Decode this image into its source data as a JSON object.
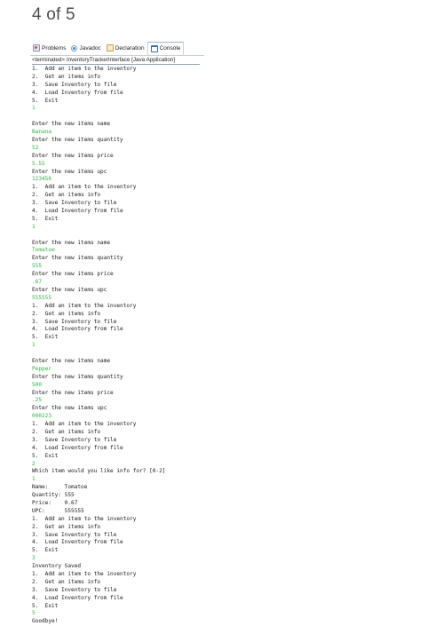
{
  "page_counter": "4 of 5",
  "tabs": [
    {
      "label": "Problems",
      "icon": "problems-icon"
    },
    {
      "label": "Javadoc",
      "icon": "javadoc-icon"
    },
    {
      "label": "Declaration",
      "icon": "declaration-icon"
    },
    {
      "label": "Console",
      "icon": "console-icon"
    }
  ],
  "terminated_line": "<terminated> InventoryTrackerInterface [Java Application]",
  "colors": {
    "input_text": "#34b04a",
    "output_text": "#1a1a1a"
  },
  "console_lines": [
    {
      "text": "1.  Add an item to the inventory",
      "type": "out"
    },
    {
      "text": "2.  Get an items info",
      "type": "out"
    },
    {
      "text": "3.  Save Inventory to file",
      "type": "out"
    },
    {
      "text": "4.  Load Inventory from file",
      "type": "out"
    },
    {
      "text": "5.  Exit",
      "type": "out"
    },
    {
      "text": "1",
      "type": "input"
    },
    {
      "text": "",
      "type": "blank"
    },
    {
      "text": "Enter the new items name",
      "type": "out"
    },
    {
      "text": "Banana",
      "type": "input"
    },
    {
      "text": "Enter the new items quantity",
      "type": "out"
    },
    {
      "text": "52",
      "type": "input"
    },
    {
      "text": "Enter the new items price",
      "type": "out"
    },
    {
      "text": "5.55",
      "type": "input"
    },
    {
      "text": "Enter the new items upc",
      "type": "out"
    },
    {
      "text": "123456",
      "type": "input"
    },
    {
      "text": "1.  Add an item to the inventory",
      "type": "out"
    },
    {
      "text": "2.  Get an items info",
      "type": "out"
    },
    {
      "text": "3.  Save Inventory to file",
      "type": "out"
    },
    {
      "text": "4.  Load Inventory from file",
      "type": "out"
    },
    {
      "text": "5.  Exit",
      "type": "out"
    },
    {
      "text": "1",
      "type": "input"
    },
    {
      "text": "",
      "type": "blank"
    },
    {
      "text": "Enter the new items name",
      "type": "out"
    },
    {
      "text": "Tomatoe",
      "type": "input"
    },
    {
      "text": "Enter the new items quantity",
      "type": "out"
    },
    {
      "text": "555",
      "type": "input"
    },
    {
      "text": "Enter the new items price",
      "type": "out"
    },
    {
      "text": ".67",
      "type": "input"
    },
    {
      "text": "Enter the new items upc",
      "type": "out"
    },
    {
      "text": "555555",
      "type": "input"
    },
    {
      "text": "1.  Add an item to the inventory",
      "type": "out"
    },
    {
      "text": "2.  Get an items info",
      "type": "out"
    },
    {
      "text": "3.  Save Inventory to file",
      "type": "out"
    },
    {
      "text": "4.  Load Inventory from file",
      "type": "out"
    },
    {
      "text": "5.  Exit",
      "type": "out"
    },
    {
      "text": "1",
      "type": "input"
    },
    {
      "text": "",
      "type": "blank"
    },
    {
      "text": "Enter the new items name",
      "type": "out"
    },
    {
      "text": "Pepper",
      "type": "input"
    },
    {
      "text": "Enter the new items quantity",
      "type": "out"
    },
    {
      "text": "500",
      "type": "input"
    },
    {
      "text": "Enter the new items price",
      "type": "out"
    },
    {
      "text": ".25",
      "type": "input"
    },
    {
      "text": "Enter the new items upc",
      "type": "out"
    },
    {
      "text": "000223",
      "type": "input"
    },
    {
      "text": "1.  Add an item to the inventory",
      "type": "out"
    },
    {
      "text": "2.  Get an items info",
      "type": "out"
    },
    {
      "text": "3.  Save Inventory to file",
      "type": "out"
    },
    {
      "text": "4.  Load Inventory from file",
      "type": "out"
    },
    {
      "text": "5.  Exit",
      "type": "out"
    },
    {
      "text": "2",
      "type": "input"
    },
    {
      "text": "Which item would you like info for? [0-2]",
      "type": "out"
    },
    {
      "text": "1",
      "type": "input"
    },
    {
      "text": "Name:     Tomatoe",
      "type": "out"
    },
    {
      "text": "Quantity: 555",
      "type": "out"
    },
    {
      "text": "Price:    0.67",
      "type": "out"
    },
    {
      "text": "UPC:      555555",
      "type": "out"
    },
    {
      "text": "1.  Add an item to the inventory",
      "type": "out"
    },
    {
      "text": "2.  Get an items info",
      "type": "out"
    },
    {
      "text": "3.  Save Inventory to file",
      "type": "out"
    },
    {
      "text": "4.  Load Inventory from file",
      "type": "out"
    },
    {
      "text": "5.  Exit",
      "type": "out"
    },
    {
      "text": "3",
      "type": "input"
    },
    {
      "text": "Inventory Saved",
      "type": "out"
    },
    {
      "text": "1.  Add an item to the inventory",
      "type": "out"
    },
    {
      "text": "2.  Get an items info",
      "type": "out"
    },
    {
      "text": "3.  Save Inventory to file",
      "type": "out"
    },
    {
      "text": "4.  Load Inventory from file",
      "type": "out"
    },
    {
      "text": "5.  Exit",
      "type": "out"
    },
    {
      "text": "5",
      "type": "input"
    },
    {
      "text": "Goodbye!",
      "type": "out"
    }
  ]
}
